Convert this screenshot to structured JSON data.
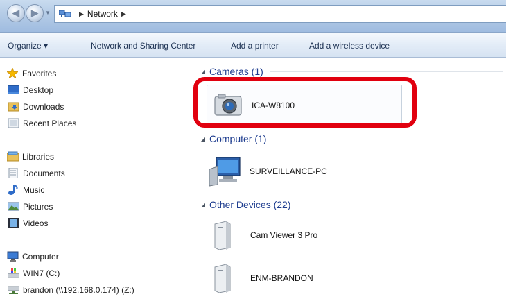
{
  "address_bar": {
    "breadcrumb": [
      "Network"
    ]
  },
  "toolbar": {
    "organize": "Organize ▾",
    "network_sharing_center": "Network and Sharing Center",
    "add_printer": "Add a printer",
    "add_wireless": "Add a wireless device"
  },
  "nav": {
    "favorites": {
      "label": "Favorites",
      "items": [
        "Desktop",
        "Downloads",
        "Recent Places"
      ]
    },
    "libraries": {
      "label": "Libraries",
      "items": [
        "Documents",
        "Music",
        "Pictures",
        "Videos"
      ]
    },
    "computer": {
      "label": "Computer",
      "items": [
        "WIN7 (C:)",
        "brandon (\\\\192.168.0.174) (Z:)"
      ]
    }
  },
  "groups": {
    "cameras": {
      "label": "Cameras (1)",
      "items": [
        "ICA-W8100"
      ]
    },
    "computer": {
      "label": "Computer (1)",
      "items": [
        "SURVEILLANCE-PC"
      ]
    },
    "other": {
      "label": "Other Devices (22)",
      "items": [
        "Cam Viewer 3 Pro",
        "ENM-BRANDON"
      ]
    }
  },
  "colors": {
    "highlight": "#e1000f",
    "group_header": "#1e3d8f",
    "toolbar_text": "#1e3354"
  }
}
